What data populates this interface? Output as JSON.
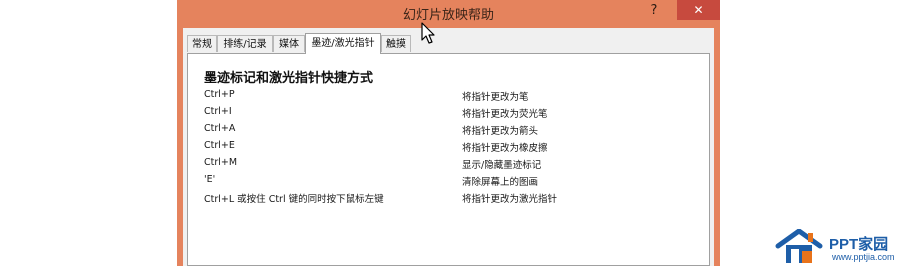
{
  "window": {
    "title": "幻灯片放映帮助",
    "help_label": "?",
    "close_label": "✕"
  },
  "tabs": [
    {
      "label": "常规"
    },
    {
      "label": "排练/记录"
    },
    {
      "label": "媒体"
    },
    {
      "label": "墨迹/激光指针",
      "active": true
    },
    {
      "label": "触摸"
    }
  ],
  "panel": {
    "heading": "墨迹标记和激光指针快捷方式",
    "rows": [
      {
        "key": "Ctrl+P",
        "desc": "将指针更改为笔"
      },
      {
        "key": "Ctrl+I",
        "desc": "将指针更改为荧光笔"
      },
      {
        "key": "Ctrl+A",
        "desc": "将指针更改为箭头"
      },
      {
        "key": "Ctrl+E",
        "desc": "将指针更改为橡皮擦"
      },
      {
        "key": "Ctrl+M",
        "desc": "显示/隐藏墨迹标记"
      },
      {
        "key": "'E'",
        "desc": "清除屏幕上的图画"
      },
      {
        "key": "Ctrl+L 或按住 Ctrl 键的同时按下鼠标左键",
        "desc": "将指针更改为激光指针"
      }
    ]
  },
  "watermark": {
    "name": "PPT家园",
    "url": "www.pptjia.com",
    "icon": "house-logo-icon"
  },
  "colors": {
    "titlebar": "#e5835d",
    "close": "#c74a3e",
    "logo_blue": "#1e5ea8",
    "logo_orange": "#e8731b"
  }
}
